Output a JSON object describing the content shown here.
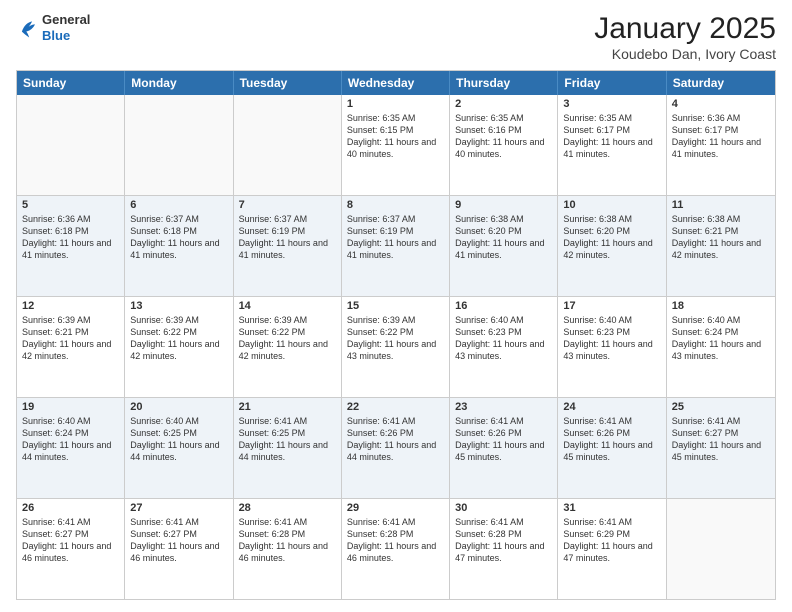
{
  "header": {
    "logo_general": "General",
    "logo_blue": "Blue",
    "month_title": "January 2025",
    "subtitle": "Koudebo Dan, Ivory Coast"
  },
  "day_headers": [
    "Sunday",
    "Monday",
    "Tuesday",
    "Wednesday",
    "Thursday",
    "Friday",
    "Saturday"
  ],
  "weeks": [
    {
      "alt": false,
      "days": [
        {
          "num": "",
          "info": ""
        },
        {
          "num": "",
          "info": ""
        },
        {
          "num": "",
          "info": ""
        },
        {
          "num": "1",
          "info": "Sunrise: 6:35 AM\nSunset: 6:15 PM\nDaylight: 11 hours and 40 minutes."
        },
        {
          "num": "2",
          "info": "Sunrise: 6:35 AM\nSunset: 6:16 PM\nDaylight: 11 hours and 40 minutes."
        },
        {
          "num": "3",
          "info": "Sunrise: 6:35 AM\nSunset: 6:17 PM\nDaylight: 11 hours and 41 minutes."
        },
        {
          "num": "4",
          "info": "Sunrise: 6:36 AM\nSunset: 6:17 PM\nDaylight: 11 hours and 41 minutes."
        }
      ]
    },
    {
      "alt": true,
      "days": [
        {
          "num": "5",
          "info": "Sunrise: 6:36 AM\nSunset: 6:18 PM\nDaylight: 11 hours and 41 minutes."
        },
        {
          "num": "6",
          "info": "Sunrise: 6:37 AM\nSunset: 6:18 PM\nDaylight: 11 hours and 41 minutes."
        },
        {
          "num": "7",
          "info": "Sunrise: 6:37 AM\nSunset: 6:19 PM\nDaylight: 11 hours and 41 minutes."
        },
        {
          "num": "8",
          "info": "Sunrise: 6:37 AM\nSunset: 6:19 PM\nDaylight: 11 hours and 41 minutes."
        },
        {
          "num": "9",
          "info": "Sunrise: 6:38 AM\nSunset: 6:20 PM\nDaylight: 11 hours and 41 minutes."
        },
        {
          "num": "10",
          "info": "Sunrise: 6:38 AM\nSunset: 6:20 PM\nDaylight: 11 hours and 42 minutes."
        },
        {
          "num": "11",
          "info": "Sunrise: 6:38 AM\nSunset: 6:21 PM\nDaylight: 11 hours and 42 minutes."
        }
      ]
    },
    {
      "alt": false,
      "days": [
        {
          "num": "12",
          "info": "Sunrise: 6:39 AM\nSunset: 6:21 PM\nDaylight: 11 hours and 42 minutes."
        },
        {
          "num": "13",
          "info": "Sunrise: 6:39 AM\nSunset: 6:22 PM\nDaylight: 11 hours and 42 minutes."
        },
        {
          "num": "14",
          "info": "Sunrise: 6:39 AM\nSunset: 6:22 PM\nDaylight: 11 hours and 42 minutes."
        },
        {
          "num": "15",
          "info": "Sunrise: 6:39 AM\nSunset: 6:22 PM\nDaylight: 11 hours and 43 minutes."
        },
        {
          "num": "16",
          "info": "Sunrise: 6:40 AM\nSunset: 6:23 PM\nDaylight: 11 hours and 43 minutes."
        },
        {
          "num": "17",
          "info": "Sunrise: 6:40 AM\nSunset: 6:23 PM\nDaylight: 11 hours and 43 minutes."
        },
        {
          "num": "18",
          "info": "Sunrise: 6:40 AM\nSunset: 6:24 PM\nDaylight: 11 hours and 43 minutes."
        }
      ]
    },
    {
      "alt": true,
      "days": [
        {
          "num": "19",
          "info": "Sunrise: 6:40 AM\nSunset: 6:24 PM\nDaylight: 11 hours and 44 minutes."
        },
        {
          "num": "20",
          "info": "Sunrise: 6:40 AM\nSunset: 6:25 PM\nDaylight: 11 hours and 44 minutes."
        },
        {
          "num": "21",
          "info": "Sunrise: 6:41 AM\nSunset: 6:25 PM\nDaylight: 11 hours and 44 minutes."
        },
        {
          "num": "22",
          "info": "Sunrise: 6:41 AM\nSunset: 6:26 PM\nDaylight: 11 hours and 44 minutes."
        },
        {
          "num": "23",
          "info": "Sunrise: 6:41 AM\nSunset: 6:26 PM\nDaylight: 11 hours and 45 minutes."
        },
        {
          "num": "24",
          "info": "Sunrise: 6:41 AM\nSunset: 6:26 PM\nDaylight: 11 hours and 45 minutes."
        },
        {
          "num": "25",
          "info": "Sunrise: 6:41 AM\nSunset: 6:27 PM\nDaylight: 11 hours and 45 minutes."
        }
      ]
    },
    {
      "alt": false,
      "days": [
        {
          "num": "26",
          "info": "Sunrise: 6:41 AM\nSunset: 6:27 PM\nDaylight: 11 hours and 46 minutes."
        },
        {
          "num": "27",
          "info": "Sunrise: 6:41 AM\nSunset: 6:27 PM\nDaylight: 11 hours and 46 minutes."
        },
        {
          "num": "28",
          "info": "Sunrise: 6:41 AM\nSunset: 6:28 PM\nDaylight: 11 hours and 46 minutes."
        },
        {
          "num": "29",
          "info": "Sunrise: 6:41 AM\nSunset: 6:28 PM\nDaylight: 11 hours and 46 minutes."
        },
        {
          "num": "30",
          "info": "Sunrise: 6:41 AM\nSunset: 6:28 PM\nDaylight: 11 hours and 47 minutes."
        },
        {
          "num": "31",
          "info": "Sunrise: 6:41 AM\nSunset: 6:29 PM\nDaylight: 11 hours and 47 minutes."
        },
        {
          "num": "",
          "info": ""
        }
      ]
    }
  ]
}
